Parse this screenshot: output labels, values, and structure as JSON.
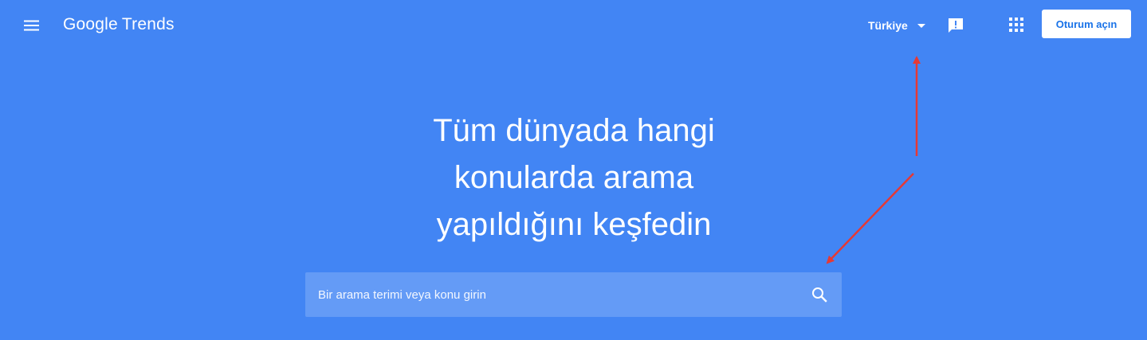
{
  "header": {
    "logo_google": "Google",
    "logo_trends": "Trends",
    "country": "Türkiye",
    "signin_label": "Oturum açın"
  },
  "hero": {
    "lines": [
      "Tüm dünyada hangi",
      "konularda arama",
      "yapıldığını keşfedin"
    ]
  },
  "search": {
    "placeholder": "Bir arama terimi veya konu girin",
    "value": ""
  },
  "icons": {
    "menu": "menu-icon",
    "country_dropdown": "caret-down-icon",
    "feedback": "feedback-icon",
    "apps": "apps-grid-icon",
    "search": "search-icon"
  },
  "colors": {
    "background": "#4285f4",
    "signin_text": "#1a73e8",
    "annotation_arrow": "#e53935"
  }
}
